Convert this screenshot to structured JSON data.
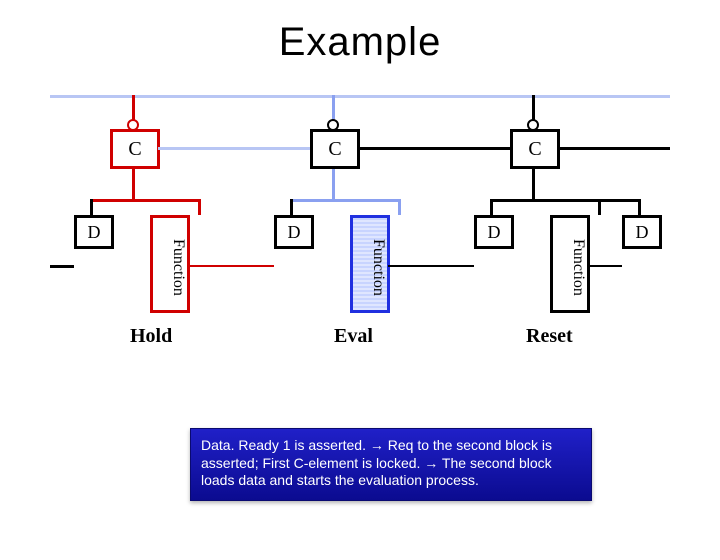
{
  "title": "Example",
  "stages": [
    {
      "c": "C",
      "d": "D",
      "f": "Function",
      "label": "Hold",
      "color": "red"
    },
    {
      "c": "C",
      "d": "D",
      "f": "Function",
      "label": "Eval",
      "color": "blue"
    },
    {
      "c": "C",
      "d": "D",
      "f": "Function",
      "label": "Reset",
      "color": "black"
    }
  ],
  "trailing_d": "D",
  "caption": "Data. Ready 1 is asserted. → Req to the second block is asserted; First C-element is locked. → The second block loads data and starts the evaluation process.",
  "chart_data": {
    "type": "diagram",
    "pipeline_stages": 3,
    "elements_per_stage": [
      "C-element",
      "D-latch",
      "Function-block"
    ],
    "stage_states": {
      "Hold": "asserted/locked",
      "Eval": "evaluating",
      "Reset": "reset"
    },
    "signals": [
      "Req",
      "Data.Ready1"
    ]
  }
}
